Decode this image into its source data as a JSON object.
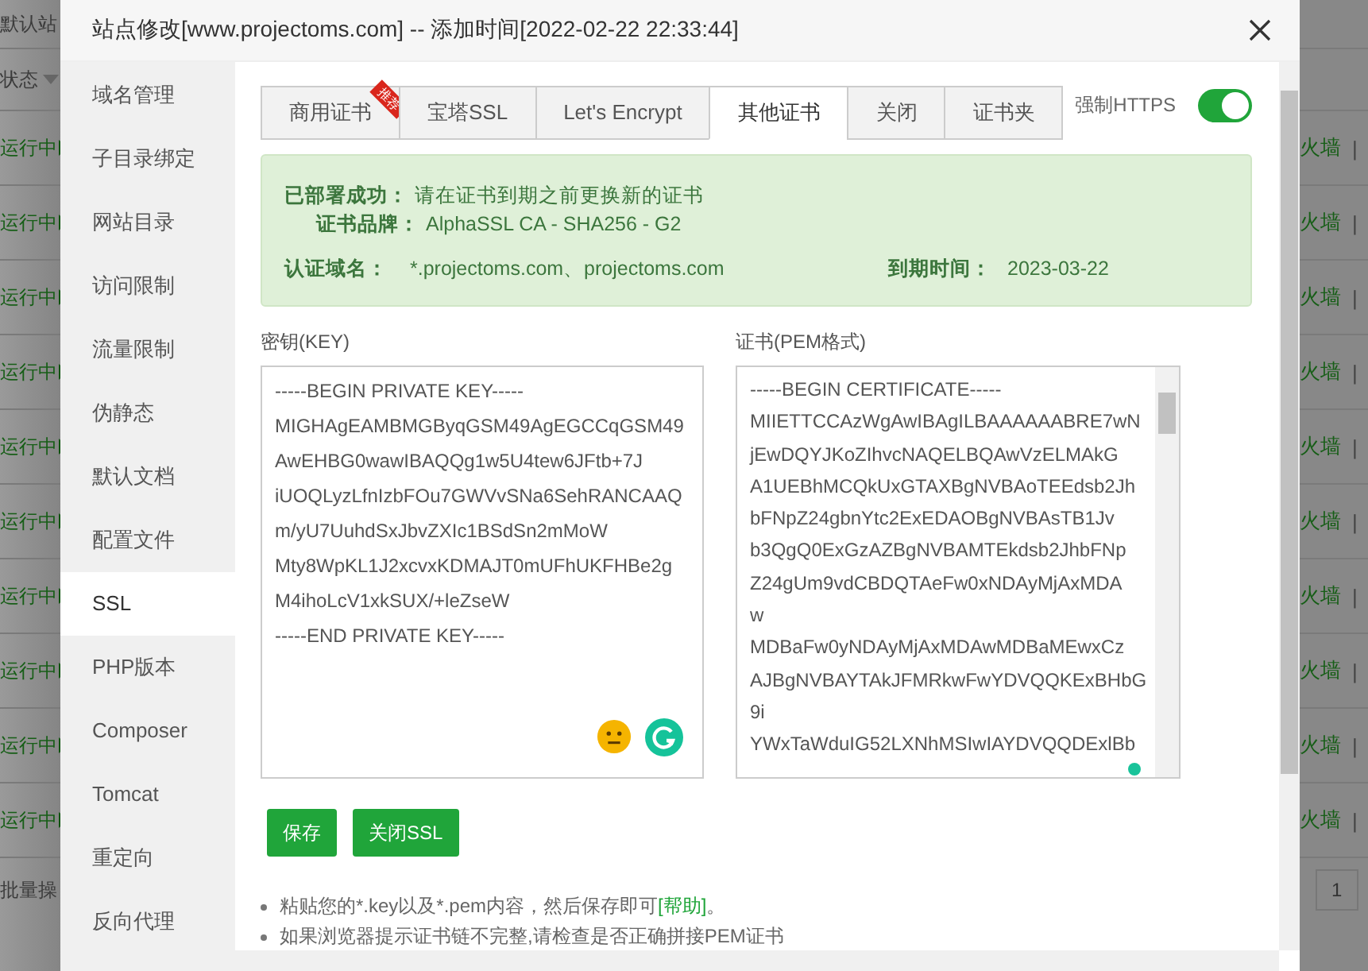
{
  "background": {
    "site_header": "默认站",
    "status_header": "状态",
    "rows": [
      {
        "status": "运行中",
        "action": "火墙",
        "separator": "|"
      },
      {
        "status": "运行中",
        "action": "火墙",
        "separator": "|"
      },
      {
        "status": "运行中",
        "action": "火墙",
        "separator": "|"
      },
      {
        "status": "运行中",
        "action": "火墙",
        "separator": "|"
      },
      {
        "status": "运行中",
        "action": "火墙",
        "separator": "|"
      },
      {
        "status": "运行中",
        "action": "火墙",
        "separator": "|"
      },
      {
        "status": "运行中",
        "action": "火墙",
        "separator": "|"
      },
      {
        "status": "运行中",
        "action": "火墙",
        "separator": "|"
      },
      {
        "status": "运行中",
        "action": "火墙",
        "separator": "|"
      },
      {
        "status": "运行中",
        "action": "火墙",
        "separator": "|"
      }
    ],
    "batch": "批量操",
    "page": "1"
  },
  "window": {
    "title": "站点修改[www.projectoms.com] -- 添加时间[2022-02-22 22:33:44]"
  },
  "sidebar": {
    "items": [
      {
        "label": "域名管理",
        "selected": false
      },
      {
        "label": "子目录绑定",
        "selected": false
      },
      {
        "label": "网站目录",
        "selected": false
      },
      {
        "label": "访问限制",
        "selected": false
      },
      {
        "label": "流量限制",
        "selected": false
      },
      {
        "label": "伪静态",
        "selected": false
      },
      {
        "label": "默认文档",
        "selected": false
      },
      {
        "label": "配置文件",
        "selected": false
      },
      {
        "label": "SSL",
        "selected": true
      },
      {
        "label": "PHP版本",
        "selected": false
      },
      {
        "label": "Composer",
        "selected": false
      },
      {
        "label": "Tomcat",
        "selected": false
      },
      {
        "label": "重定向",
        "selected": false
      },
      {
        "label": "反向代理",
        "selected": false
      }
    ]
  },
  "tabs": [
    {
      "label": "商用证书",
      "selected": false,
      "badge": "推荐"
    },
    {
      "label": "宝塔SSL",
      "selected": false
    },
    {
      "label": "Let's Encrypt",
      "selected": false
    },
    {
      "label": "其他证书",
      "selected": true
    },
    {
      "label": "关闭",
      "selected": false
    },
    {
      "label": "证书夹",
      "selected": false
    }
  ],
  "force_https": {
    "label": "强制HTTPS",
    "on": true
  },
  "status_box": {
    "deployed": {
      "label": "已部署成功：",
      "value": "请在证书到期之前更换新的证书"
    },
    "brand": {
      "label": "证书品牌：",
      "value": "AlphaSSL CA - SHA256 - G2"
    },
    "domains": {
      "label": "认证域名：",
      "value": "*.projectoms.com、projectoms.com"
    },
    "expiry": {
      "label": "到期时间：",
      "value": "2023-03-22"
    }
  },
  "key": {
    "label": "密钥(KEY)",
    "lines": [
      "-----BEGIN PRIVATE KEY-----",
      "MIGHAgEAMBMGByqGSM49AgEGCCqGSM49",
      "AwEHBG0wawIBAQQg1w5U4tew6JFtb+7J",
      "iUOQLyzLfnIzbFOu7GWVvSNa6SehRANCAAQ",
      "m/yU7UuhdSxJbvZXIc1BSdSn2mMoW",
      "Mty8WpKL1J2xcvxKDMAJT0mUFhUKFHBe2g",
      "M4ihoLcV1xkSUX/+leZseW",
      "-----END PRIVATE KEY-----"
    ]
  },
  "certificate": {
    "label": "证书(PEM格式)",
    "lines": [
      "-----BEGIN CERTIFICATE-----",
      "MIIETTCCAzWgAwIBAgILBAAAAAABRE7wN",
      "jEwDQYJKoZIhvcNAQELBQAwVzELMAkG",
      "A1UEBhMCQkUxGTAXBgNVBAoTEEdsb2Jh",
      "bFNpZ24gbnYtc2ExEDAOBgNVBAsTB1Jv",
      "b3QgQ0ExGzAZBgNVBAMTEkdsb2JhbFNp",
      "Z24gUm9vdCBDQTAeFw0xNDAyMjAxMDA",
      "w",
      "MDBaFw0yNDAyMjAxMDAwMDBaMEwxCz",
      "AJBgNVBAYTAkJFMRkwFwYDVQQKExBHbG",
      "9i",
      "YWxTaWduIG52LXNhMSIwIAYDVQQDExlBb"
    ]
  },
  "buttons": [
    {
      "label": "保存"
    },
    {
      "label": "关闭SSL"
    }
  ],
  "notes": [
    {
      "text": "粘贴您的*.key以及*.pem内容，然后保存即可",
      "link": "[帮助]",
      "after": "。"
    },
    {
      "text": "如果浏览器提示证书链不完整,请检查是否正确拼接PEM证书"
    }
  ]
}
